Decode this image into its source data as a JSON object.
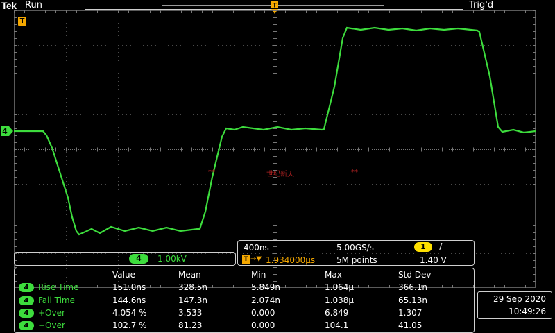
{
  "header": {
    "brand": "Tek",
    "run_state": "Run",
    "trigger_status": "Trig'd"
  },
  "markers": {
    "trigger_label": "T",
    "channel": "4"
  },
  "watermark": {
    "left": "**",
    "center": "世纪新天",
    "right": "**"
  },
  "channel_info": {
    "channel": "4",
    "scale": "1.00kV"
  },
  "horizontal": {
    "time_div": "400ns",
    "sample_rate": "5.00GS/s",
    "trigger_channel": "1",
    "trigger_slope_icon": "rising-edge-icon",
    "trigger_slope_glyph": "/",
    "trigger_level": "1.40 V",
    "trigger_position_label": "T",
    "trigger_position_arrow": "→▼",
    "trigger_position": "1.934000μs",
    "record_length": "5M points"
  },
  "measurements": {
    "columns": [
      "Value",
      "Mean",
      "Min",
      "Max",
      "Std Dev"
    ],
    "rows": [
      {
        "channel": "4",
        "name": "Rise Time",
        "value": "151.0ns",
        "mean": "328.5n",
        "min": "5.849n",
        "max": "1.064μ",
        "std": "366.1n"
      },
      {
        "channel": "4",
        "name": "Fall Time",
        "value": "144.6ns",
        "mean": "147.3n",
        "min": "2.074n",
        "max": "1.038μ",
        "std": "65.13n"
      },
      {
        "channel": "4",
        "name": "+Over",
        "value": "4.054 %",
        "mean": "3.533",
        "min": "0.000",
        "max": "6.849",
        "std": "1.307"
      },
      {
        "channel": "4",
        "name": "−Over",
        "value": "102.7 %",
        "mean": "81.23",
        "min": "0.000",
        "max": "104.1",
        "std": "41.05"
      }
    ]
  },
  "datetime": {
    "date": "29 Sep  2020",
    "time": "10:49:26"
  },
  "colors": {
    "trace": "#3ddc3d",
    "trigger_marker": "#f5a800",
    "trigger_badge": "#ffe000",
    "watermark": "#b22222"
  }
}
